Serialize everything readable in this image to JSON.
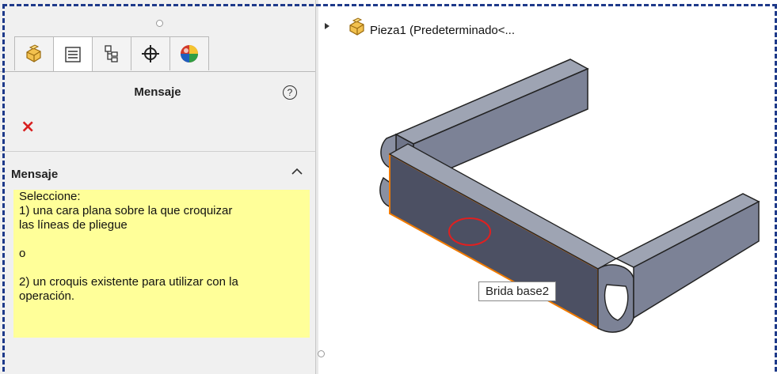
{
  "panel": {
    "tabs": [
      {
        "name": "feature-manager",
        "icon": "part-icon"
      },
      {
        "name": "property-manager",
        "icon": "property-list-icon"
      },
      {
        "name": "configuration-manager",
        "icon": "configuration-icon"
      },
      {
        "name": "dimxpert-manager",
        "icon": "crosshair-icon"
      },
      {
        "name": "display-manager",
        "icon": "appearance-ball-icon"
      }
    ],
    "title": "Mensaje",
    "help_icon": "?",
    "close_icon": "×",
    "section_title": "Mensaje",
    "message_lines": [
      "Seleccione:",
      "1) una cara plana sobre la que croquizar",
      "las líneas de pliegue",
      "",
      "o",
      "",
      "2) un croquis existente para utilizar con la",
      "operación."
    ]
  },
  "viewport": {
    "tree_label": "Pieza1  (Predeterminado<...",
    "tooltip": "Brida base2"
  },
  "colors": {
    "message_bg": "#ffff99",
    "accent_dashed": "#1e3a8a",
    "close_red": "#d81f1f",
    "highlight_orange": "#f07a00",
    "selection_circle": "#e02020"
  }
}
